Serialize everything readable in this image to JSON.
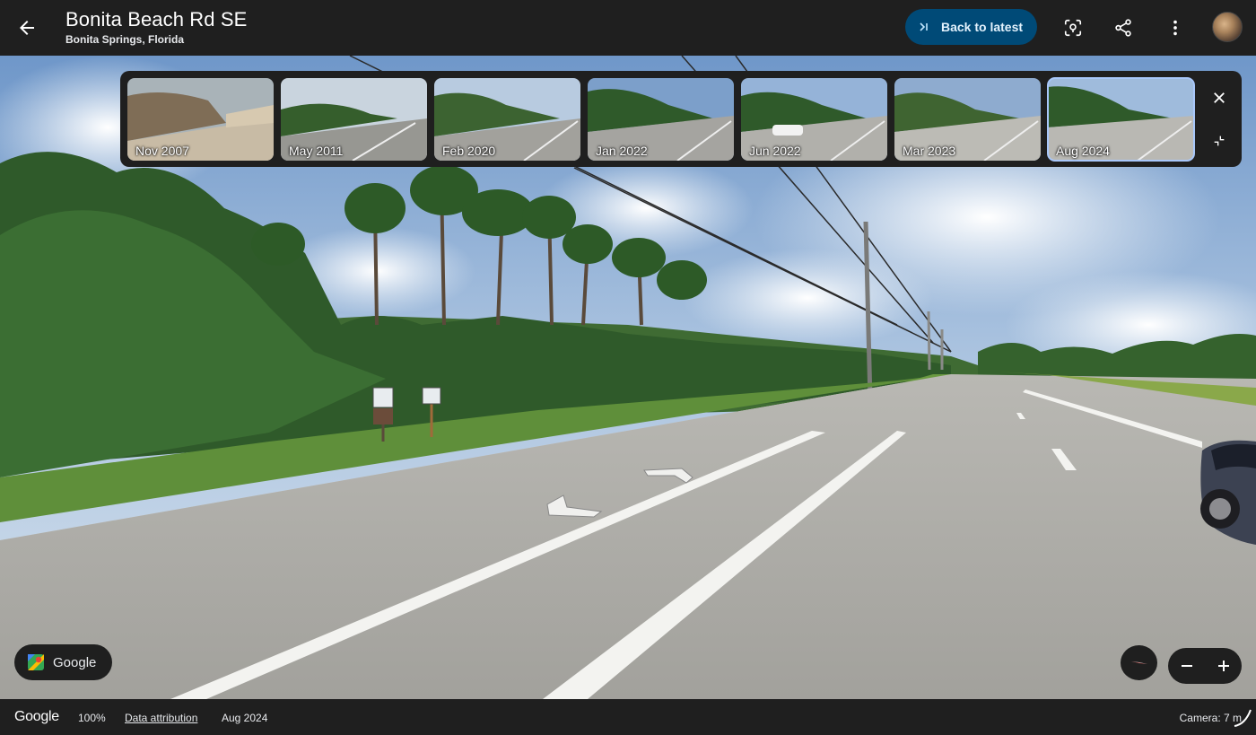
{
  "header": {
    "title": "Bonita Beach Rd SE",
    "subtitle": "Bonita Springs, Florida",
    "back_to_latest_label": "Back to latest"
  },
  "timeline": {
    "thumbnails": [
      {
        "label": "Nov 2007",
        "selected": false
      },
      {
        "label": "May 2011",
        "selected": false
      },
      {
        "label": "Feb 2020",
        "selected": false
      },
      {
        "label": "Jan 2022",
        "selected": false
      },
      {
        "label": "Jun 2022",
        "selected": false
      },
      {
        "label": "Mar 2023",
        "selected": false
      },
      {
        "label": "Aug 2024",
        "selected": true
      }
    ]
  },
  "overlay": {
    "google_chip_label": "Google"
  },
  "footer": {
    "logo": "Google",
    "zoom_level": "100%",
    "data_attribution": "Data attribution",
    "date": "Aug 2024",
    "camera": "Camera: 7 m"
  },
  "icons": {
    "back": "arrow-left-icon",
    "back_to_latest": "skip-forward-icon",
    "lens": "lens-search-icon",
    "share": "share-icon",
    "more": "more-vert-icon",
    "close": "close-icon",
    "collapse": "collapse-icon",
    "compass": "compass-icon",
    "zoom_out": "minus-icon",
    "zoom_in": "plus-icon"
  },
  "colors": {
    "chrome_bg": "#1f1f1f",
    "accent_button_bg": "#004a77",
    "selected_outline": "#a8c7fa"
  }
}
